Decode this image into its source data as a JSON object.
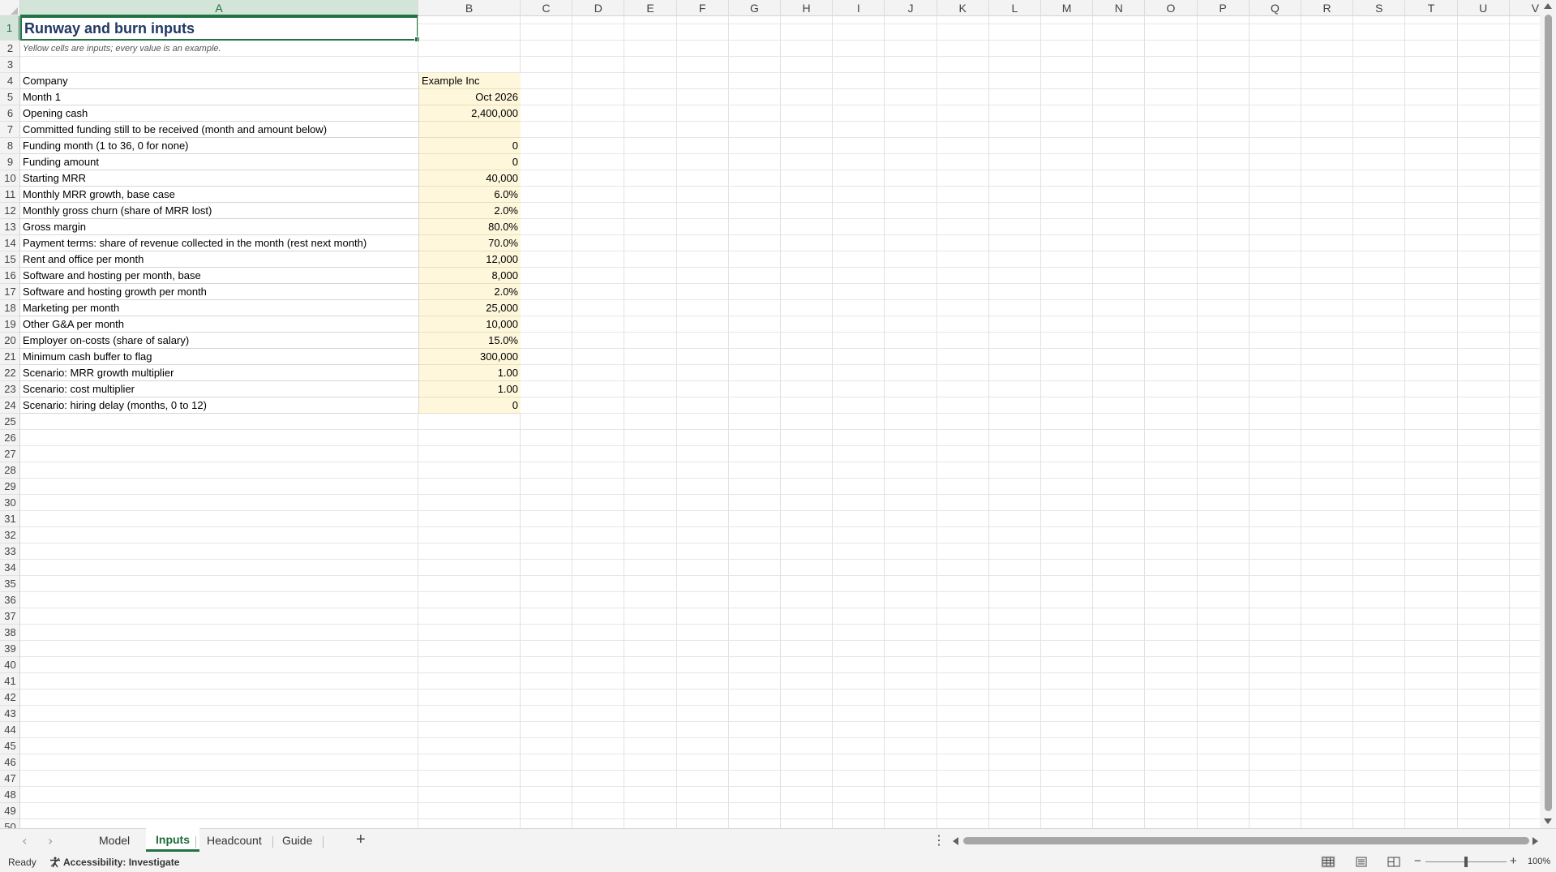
{
  "columns": [
    "A",
    "B",
    "C",
    "D",
    "E",
    "F",
    "G",
    "H",
    "I",
    "J",
    "K",
    "L",
    "M",
    "N",
    "O",
    "P",
    "Q",
    "R",
    "S",
    "T",
    "U",
    "V"
  ],
  "active_column": "A",
  "active_row": "1",
  "rows": [
    "1",
    "2",
    "3",
    "4",
    "5",
    "6",
    "7",
    "8",
    "9",
    "10",
    "11",
    "12",
    "13",
    "14",
    "15",
    "16",
    "17",
    "18",
    "19",
    "20",
    "21",
    "22",
    "23",
    "24",
    "25",
    "26",
    "27",
    "28",
    "29",
    "30",
    "31",
    "32",
    "33",
    "34",
    "35",
    "36",
    "37",
    "38",
    "39",
    "40",
    "41",
    "42",
    "43",
    "44",
    "45",
    "46",
    "47",
    "48",
    "49",
    "50"
  ],
  "sheet": {
    "title": "Runway and burn inputs",
    "subtitle": "Yellow cells are inputs; every value is an example.",
    "inputs": [
      {
        "label": "Company",
        "value": "Example Inc",
        "align": "left"
      },
      {
        "label": "Month 1",
        "value": "Oct 2026"
      },
      {
        "label": "Opening cash",
        "value": "2,400,000"
      },
      {
        "label": "Committed funding still to be received (month and amount below)",
        "value": ""
      },
      {
        "label": "Funding month (1 to 36, 0 for none)",
        "value": "0"
      },
      {
        "label": "Funding amount",
        "value": "0"
      },
      {
        "label": "Starting MRR",
        "value": "40,000"
      },
      {
        "label": "Monthly MRR growth, base case",
        "value": "6.0%"
      },
      {
        "label": "Monthly gross churn (share of MRR lost)",
        "value": "2.0%"
      },
      {
        "label": "Gross margin",
        "value": "80.0%"
      },
      {
        "label": "Payment terms: share of revenue collected in the month (rest next month)",
        "value": "70.0%"
      },
      {
        "label": "Rent and office per month",
        "value": "12,000"
      },
      {
        "label": "Software and hosting per month, base",
        "value": "8,000"
      },
      {
        "label": "Software and hosting growth per month",
        "value": "2.0%"
      },
      {
        "label": "Marketing per month",
        "value": "25,000"
      },
      {
        "label": "Other G&A per month",
        "value": "10,000"
      },
      {
        "label": "Employer on-costs (share of salary)",
        "value": "15.0%"
      },
      {
        "label": "Minimum cash buffer to flag",
        "value": "300,000"
      },
      {
        "label": "Scenario: MRR growth multiplier",
        "value": "1.00"
      },
      {
        "label": "Scenario: cost multiplier",
        "value": "1.00"
      },
      {
        "label": "Scenario: hiring delay (months, 0 to 12)",
        "value": "0"
      }
    ]
  },
  "tabs": {
    "prev": "‹",
    "next": "›",
    "items": [
      {
        "label": "Model",
        "active": false
      },
      {
        "label": "Inputs",
        "active": true
      },
      {
        "label": "Headcount",
        "active": false
      },
      {
        "label": "Guide",
        "active": false
      }
    ],
    "add": "+",
    "more": "⋮"
  },
  "status": {
    "ready": "Ready",
    "accessibility": "Accessibility: Investigate",
    "zoom_minus": "−",
    "zoom_plus": "+",
    "zoom": "100%",
    "zoom_fraction": 0.5
  },
  "colors": {
    "accent": "#217346",
    "input_fill": "#fff7dc",
    "title_text": "#1f3864"
  }
}
